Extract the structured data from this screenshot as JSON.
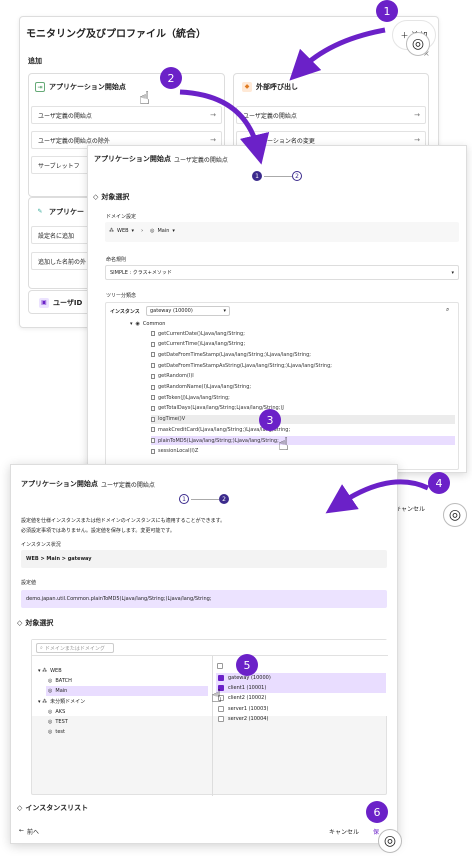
{
  "panel1": {
    "title": "モニタリング及びプロファイル（統合）",
    "add_button": "追加",
    "close_icon": "×",
    "section": "追加",
    "card_app": {
      "title": "アプリケーション開始点",
      "rows": [
        "ユーザ定義の開始点",
        "ユーザ定義の開始点の除外",
        "サーブレットフ"
      ]
    },
    "card_ext": {
      "title": "外部呼び出し",
      "rows": [
        "ユーザ定義の開始点",
        "アプリケーション名の変更"
      ]
    },
    "card_app2": {
      "title": "アプリケー",
      "rows": [
        "設定名に追加",
        "追加した名前の外"
      ]
    },
    "card_user": {
      "title": "ユーザID"
    }
  },
  "panel2": {
    "title": "アプリケーション開始点",
    "subtitle": "ユーザ定義の開始点",
    "steps": [
      "1",
      "2"
    ],
    "section_target": "対象選択",
    "domain_label": "ドメイン設定",
    "domain_path": [
      "WEB",
      "Main"
    ],
    "naming_label": "命名規則",
    "naming_value": "SIMPLE : クラス+メソッド",
    "tree_label": "ツリー分類念",
    "instance_label": "インスタンス",
    "instance_value": "gateway (10000)",
    "tree_root": "Common",
    "tree_items": [
      "getCurrentDate()Ljava/lang/String;",
      "getCurrentTime()Ljava/lang/String;",
      "getDateFromTimeStamp(Ljava/lang/String;)Ljava/lang/String;",
      "getDateFromTimeStampAsString(Ljava/lang/String;)Ljava/lang/String;",
      "getRandom(I)I",
      "getRandomName(I)Ljava/lang/String;",
      "getToken(J)Ljava/lang/String;",
      "getTotalDays(Ljava/lang/String;Ljava/lang/String;)J",
      "logTime()V",
      "maskCreditCard(Ljava/lang/String;)Ljava/lang/String;",
      "plainToMD5(Ljava/lang/String;)Ljava/lang/String;",
      "sessionLocal(I)Z"
    ],
    "highlight_index": 10,
    "hover_index": 8,
    "footer_cancel": "キャンセル"
  },
  "panel3": {
    "title": "アプリケーション開始点",
    "subtitle": "ユーザ定義の開始点",
    "steps": [
      "1",
      "2"
    ],
    "desc1": "設定値を仕様インスタンスまたは他ドメインのインスタンスにも適用することができます。",
    "desc2": "必須設定事項ではありません。設定値を保存します。変更可能です。",
    "instance_status_label": "インスタンス状況",
    "instance_status_value": "WEB > Main > gateway",
    "setting_label": "設定値",
    "setting_value": "demo.japan.util.Common.plainToMD5(Ljava/lang/String;)Ljava/lang/String;",
    "section_target": "対象選択",
    "search_placeholder": "ドメインまたはドメイング",
    "left_tree": [
      {
        "label": "WEB",
        "level": 0
      },
      {
        "label": "BATCH",
        "level": 1
      },
      {
        "label": "Main",
        "level": 1
      },
      {
        "label": "未分類ドメイン",
        "level": 0
      },
      {
        "label": "AKS",
        "level": 1
      },
      {
        "label": "TEST",
        "level": 1
      },
      {
        "label": "test",
        "level": 1
      }
    ],
    "instances": [
      {
        "label": "gateway (10000)",
        "checked": true
      },
      {
        "label": "client1 (10001)",
        "checked": true
      },
      {
        "label": "client2 (10002)",
        "checked": false
      },
      {
        "label": "server1 (10003)",
        "checked": false
      },
      {
        "label": "server2 (10004)",
        "checked": false
      }
    ],
    "section_instances": "インスタンスリスト",
    "back_label": "前へ",
    "cancel_label": "キャンセル",
    "save_label": "保"
  },
  "callouts": [
    "1",
    "2",
    "3",
    "4",
    "5",
    "6"
  ],
  "colors": {
    "accent": "#6b21c8",
    "highlight": "#e9ddff",
    "hover": "#ececec"
  }
}
